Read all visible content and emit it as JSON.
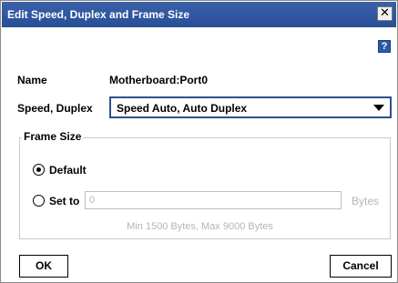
{
  "dialog": {
    "title": "Edit Speed, Duplex and Frame Size",
    "close_glyph": "✕",
    "help_glyph": "?",
    "help_icon": "help-icon",
    "close_icon": "close-icon",
    "title_bar_color": "#2f57a0"
  },
  "name_row": {
    "label": "Name",
    "value": "Motherboard:Port0"
  },
  "speed_row": {
    "label": "Speed, Duplex",
    "selected": "Speed Auto, Auto Duplex",
    "dropdown_icon": "chevron-down-icon"
  },
  "frame_size": {
    "legend": "Frame Size",
    "default_label": "Default",
    "default_selected": true,
    "set_to_label": "Set to",
    "set_to_value": "0",
    "unit": "Bytes",
    "hint": "Min 1500 Bytes, Max 9000 Bytes"
  },
  "buttons": {
    "ok": "OK",
    "cancel": "Cancel"
  }
}
